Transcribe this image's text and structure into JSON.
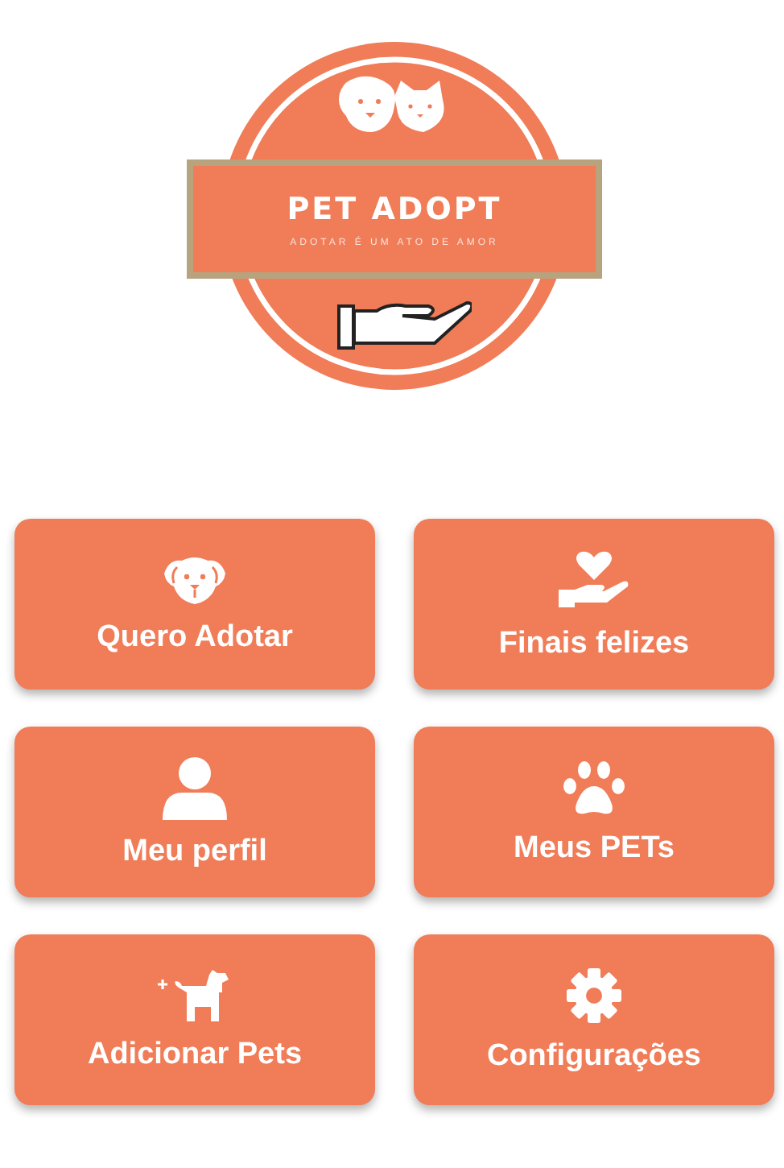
{
  "logo": {
    "title": "PET ADOPT",
    "tagline": "ADOTAR É UM ATO DE AMOR"
  },
  "menu": [
    {
      "label": "Quero Adotar"
    },
    {
      "label": "Finais felizes"
    },
    {
      "label": "Meu perfil"
    },
    {
      "label": "Meus PETs"
    },
    {
      "label": "Adicionar Pets"
    },
    {
      "label": "Configurações"
    }
  ]
}
